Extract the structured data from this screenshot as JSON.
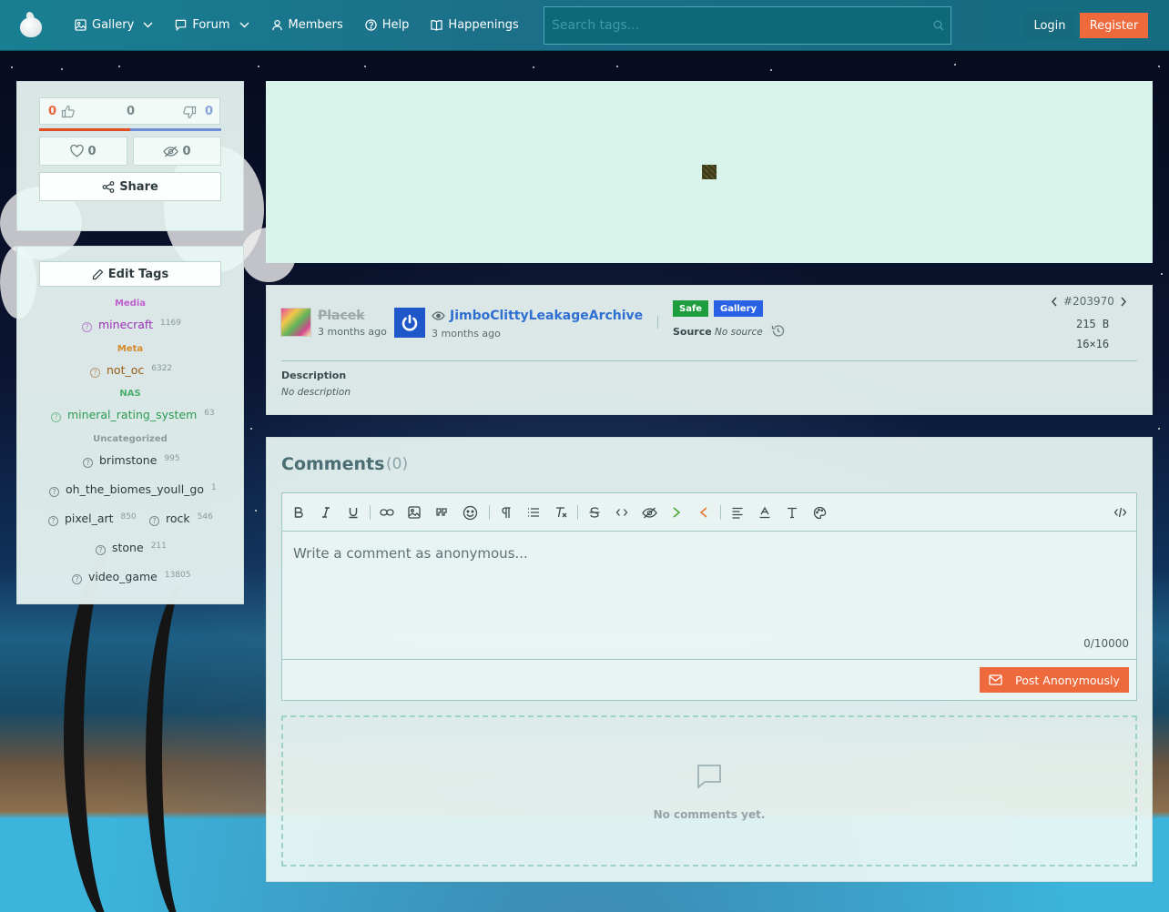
{
  "nav": {
    "items": [
      {
        "label": "Gallery",
        "icon": "image-icon",
        "dropdown": true
      },
      {
        "label": "Forum",
        "icon": "chat-icon",
        "dropdown": true
      },
      {
        "label": "Members",
        "icon": "user-icon",
        "dropdown": false
      },
      {
        "label": "Help",
        "icon": "help-circle-icon",
        "dropdown": false
      },
      {
        "label": "Happenings",
        "icon": "book-icon",
        "dropdown": false
      }
    ],
    "search_placeholder": "Search tags...",
    "login": "Login",
    "register": "Register"
  },
  "votes": {
    "up": "0",
    "score": "0",
    "down": "0",
    "favorites": "0",
    "hidden": "0",
    "share_label": "Share"
  },
  "tags": {
    "edit_label": "Edit Tags",
    "categories": [
      {
        "name": "Media",
        "color": "#c05fcf",
        "tags": [
          {
            "name": "minecraft",
            "count": "1169",
            "color": "#9b2fb5"
          }
        ]
      },
      {
        "name": "Meta",
        "color": "#d58a2c",
        "tags": [
          {
            "name": "not_oc",
            "count": "6322",
            "color": "#9a5a14"
          }
        ]
      },
      {
        "name": "NAS",
        "color": "#4cae6c",
        "tags": [
          {
            "name": "mineral_rating_system",
            "count": "63",
            "color": "#2a9a4f"
          }
        ]
      },
      {
        "name": "Uncategorized",
        "color": "#8a9a9c",
        "tags": [
          {
            "name": "brimstone",
            "count": "995",
            "color": "#2d3b3e"
          },
          {
            "name": "oh_the_biomes_youll_go",
            "count": "1",
            "color": "#2d3b3e"
          },
          {
            "name": "pixel_art",
            "count": "850",
            "color": "#2d3b3e"
          },
          {
            "name": "rock",
            "count": "546",
            "color": "#2d3b3e"
          },
          {
            "name": "stone",
            "count": "211",
            "color": "#2d3b3e"
          },
          {
            "name": "video_game",
            "count": "13805",
            "color": "#2d3b3e"
          }
        ]
      }
    ]
  },
  "post": {
    "uploader": "Placek",
    "uploader_time": "3 months ago",
    "approver": "JimboClittyLeakageArchive",
    "approver_time": "3 months ago",
    "rating_badge": "Safe",
    "gallery_badge": "Gallery",
    "source_label": "Source",
    "source_value": "No source",
    "id": "#203970",
    "size": "215 B",
    "dimensions": "16×16",
    "description_label": "Description",
    "description_value": "No description"
  },
  "comments": {
    "title": "Comments",
    "count": "(0)",
    "placeholder": "Write a comment as anonymous...",
    "char_count": "0/10000",
    "post_button": "Post Anonymously",
    "empty_text": "No comments yet."
  },
  "colors": {
    "accent": "#ee6a3c",
    "topbar": "#1a7f92",
    "safe": "#1e9d3e",
    "gallery": "#2a62e6",
    "link": "#2f6fd1"
  }
}
